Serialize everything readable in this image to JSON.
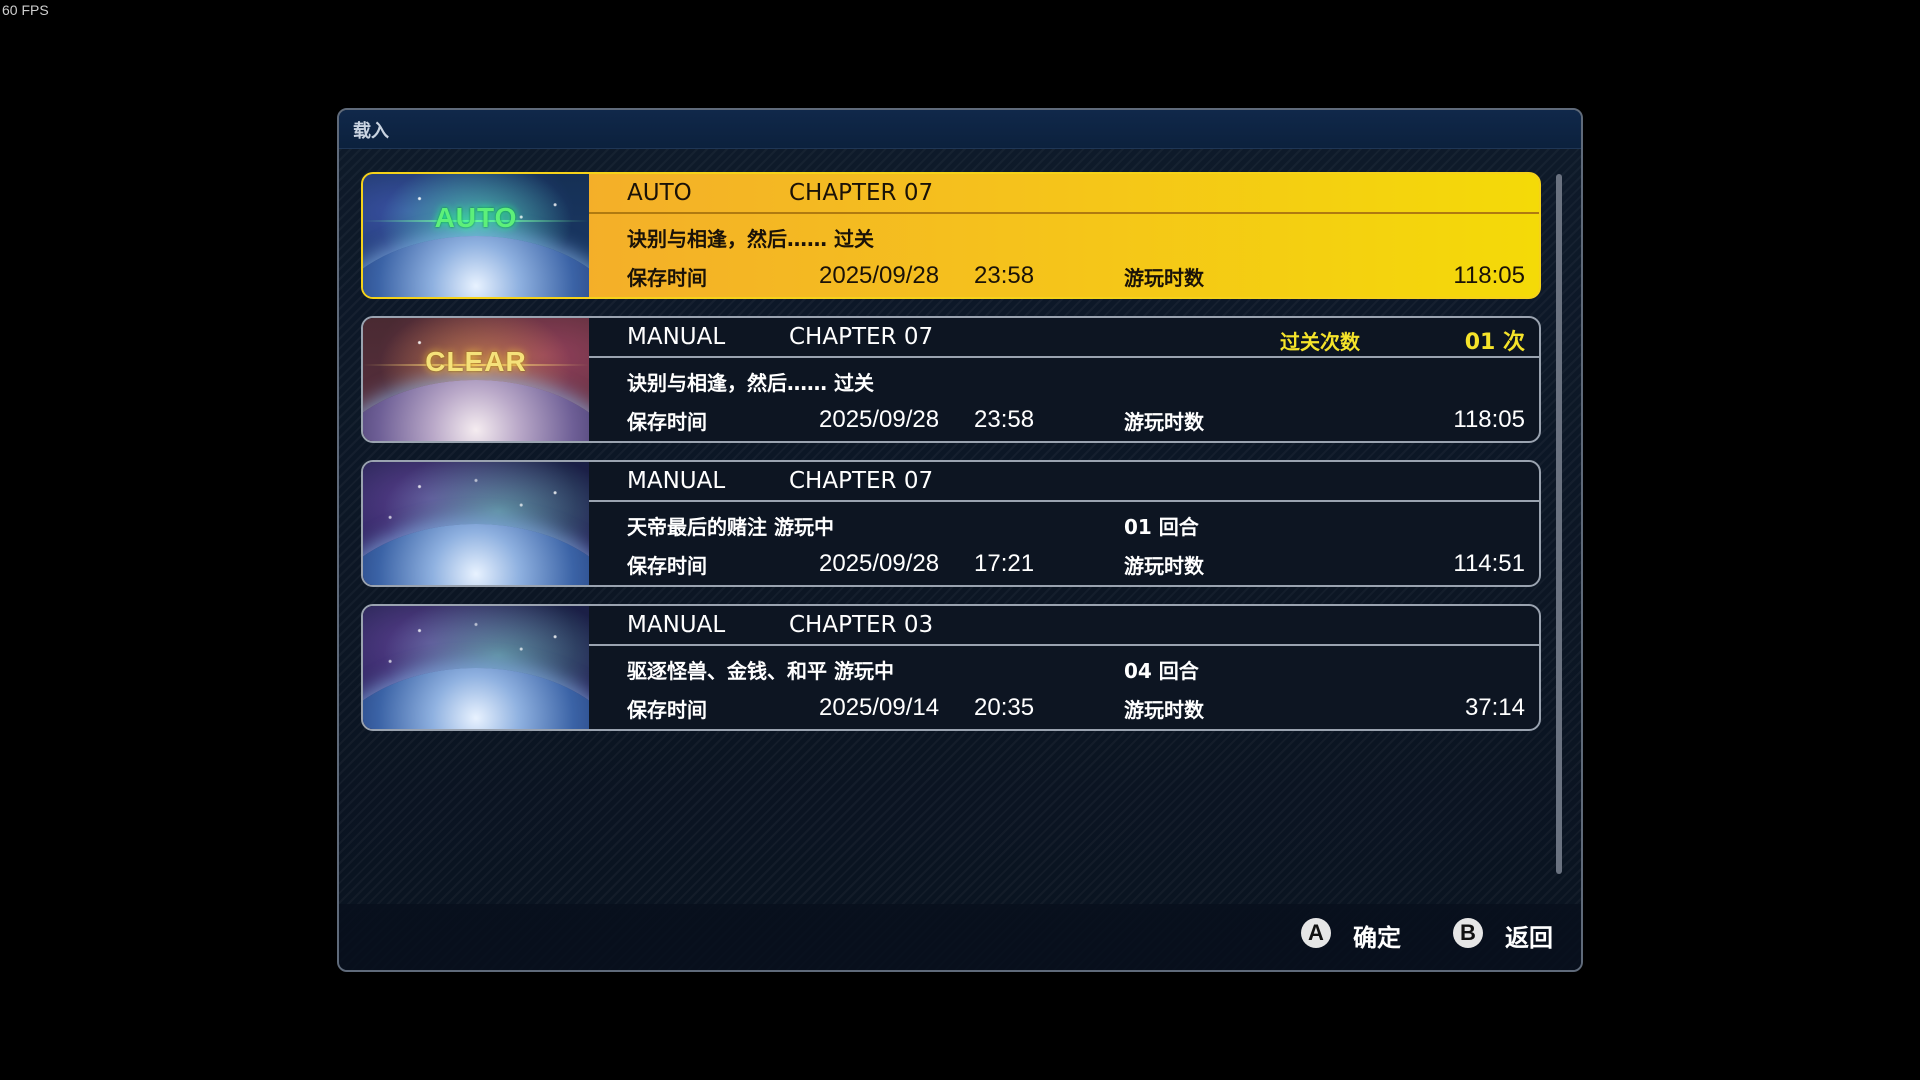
{
  "fps": "60 FPS",
  "dialog": {
    "title": "载入"
  },
  "slots": [
    {
      "type": "AUTO",
      "badge": "AUTO",
      "chapter": "CHAPTER 07",
      "description": "诀别与相逢，然后…… 过关",
      "round": "",
      "clear_label": "",
      "clear_count": "",
      "save_label": "保存时间",
      "date": "2025/09/28",
      "time": "23:58",
      "play_label": "游玩时数",
      "play_time": "118:05",
      "selected": true
    },
    {
      "type": "MANUAL",
      "badge": "CLEAR",
      "chapter": "CHAPTER 07",
      "description": "诀别与相逢，然后…… 过关",
      "round": "",
      "clear_label": "过关次数",
      "clear_count": "01 次",
      "save_label": "保存时间",
      "date": "2025/09/28",
      "time": "23:58",
      "play_label": "游玩时数",
      "play_time": "118:05",
      "selected": false
    },
    {
      "type": "MANUAL",
      "badge": "",
      "chapter": "CHAPTER 07",
      "description": "天帝最后的赌注 游玩中",
      "round": "01 回合",
      "clear_label": "",
      "clear_count": "",
      "save_label": "保存时间",
      "date": "2025/09/28",
      "time": "17:21",
      "play_label": "游玩时数",
      "play_time": "114:51",
      "selected": false
    },
    {
      "type": "MANUAL",
      "badge": "",
      "chapter": "CHAPTER 03",
      "description": "驱逐怪兽、金钱、和平 游玩中",
      "round": "04 回合",
      "clear_label": "",
      "clear_count": "",
      "save_label": "保存时间",
      "date": "2025/09/14",
      "time": "20:35",
      "play_label": "游玩时数",
      "play_time": "37:14",
      "selected": false
    }
  ],
  "footer": {
    "confirm_key": "A",
    "confirm_label": "确定",
    "back_key": "B",
    "back_label": "返回"
  },
  "colors": {
    "selected_gradient_start": "#f3a530",
    "selected_gradient_end": "#f4da08",
    "clear_count_text": "#f5e32a",
    "auto_badge": "#5df07a",
    "clear_badge": "#f5e27a"
  }
}
